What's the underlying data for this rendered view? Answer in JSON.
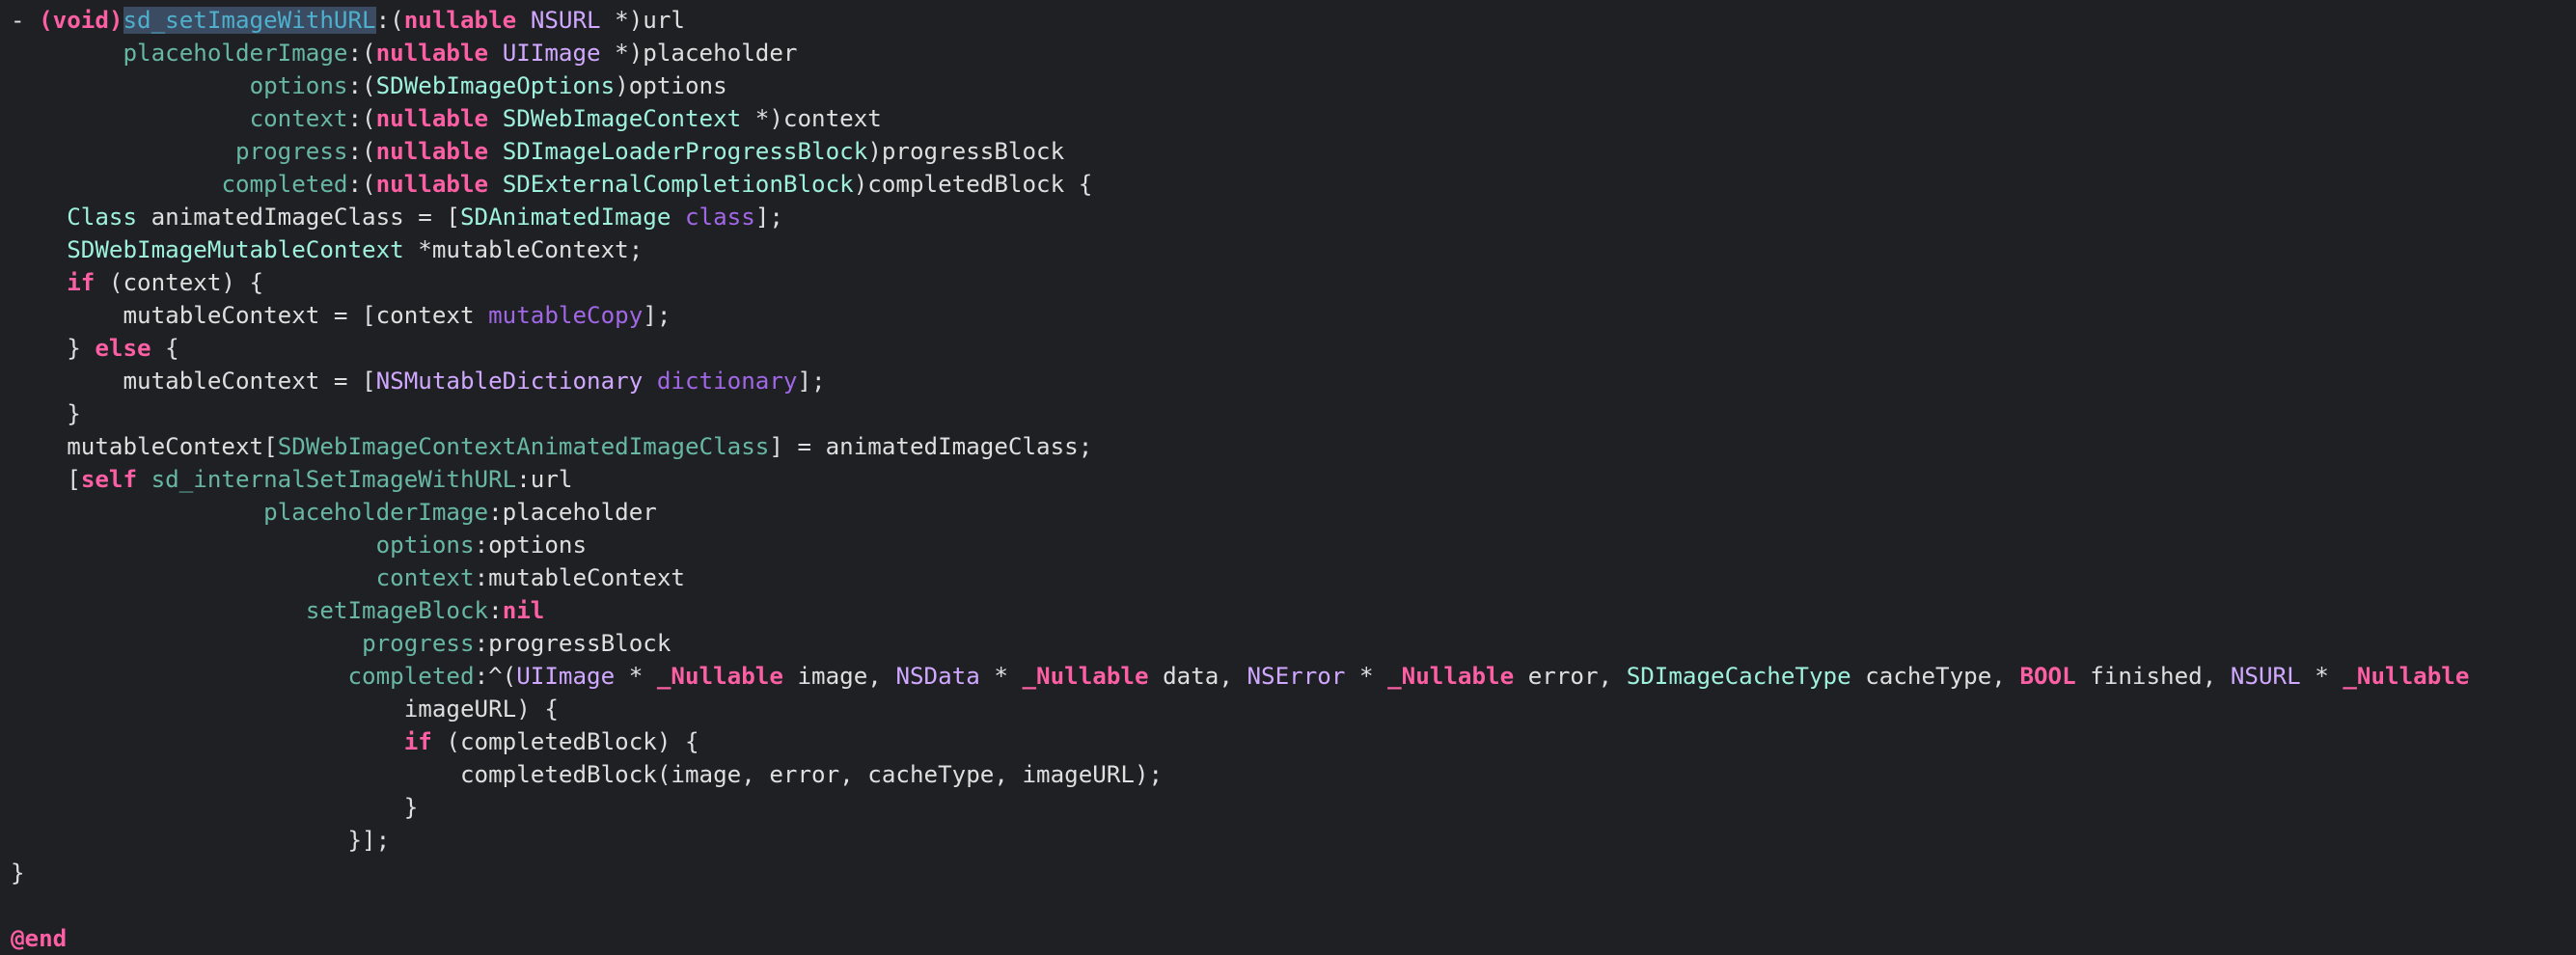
{
  "editor": {
    "background": "#1f2024",
    "selected_text": "sd_setImageWithURL",
    "colors": {
      "text": "#dfdfe0",
      "keyword": "#fc5fa3",
      "system_type": "#d0a8ff",
      "project_type": "#9ef1dd",
      "class_method": "#a167e6",
      "param_label": "#67b7a4",
      "method_name": "#4eb0cc",
      "selection": "#3b4b62"
    },
    "lines": [
      [
        [
          "text",
          "- "
        ],
        [
          "kw",
          "(void)"
        ],
        [
          "hl",
          "sd_setImageWithURL"
        ],
        [
          "text",
          ":("
        ],
        [
          "kw",
          "nullable"
        ],
        [
          "text",
          " "
        ],
        [
          "type",
          "NSURL"
        ],
        [
          "text",
          " *)url"
        ]
      ],
      [
        [
          "text",
          "        "
        ],
        [
          "param",
          "placeholderImage"
        ],
        [
          "text",
          ":("
        ],
        [
          "kw",
          "nullable"
        ],
        [
          "text",
          " "
        ],
        [
          "type",
          "UIImage"
        ],
        [
          "text",
          " *)placeholder"
        ]
      ],
      [
        [
          "text",
          "                 "
        ],
        [
          "param",
          "options"
        ],
        [
          "text",
          ":("
        ],
        [
          "ptype",
          "SDWebImageOptions"
        ],
        [
          "text",
          ")options"
        ]
      ],
      [
        [
          "text",
          "                 "
        ],
        [
          "param",
          "context"
        ],
        [
          "text",
          ":("
        ],
        [
          "kw",
          "nullable"
        ],
        [
          "text",
          " "
        ],
        [
          "ptype",
          "SDWebImageContext"
        ],
        [
          "text",
          " *)context"
        ]
      ],
      [
        [
          "text",
          "                "
        ],
        [
          "param",
          "progress"
        ],
        [
          "text",
          ":("
        ],
        [
          "kw",
          "nullable"
        ],
        [
          "text",
          " "
        ],
        [
          "ptype",
          "SDImageLoaderProgressBlock"
        ],
        [
          "text",
          ")progressBlock"
        ]
      ],
      [
        [
          "text",
          "               "
        ],
        [
          "param",
          "completed"
        ],
        [
          "text",
          ":("
        ],
        [
          "kw",
          "nullable"
        ],
        [
          "text",
          " "
        ],
        [
          "ptype",
          "SDExternalCompletionBlock"
        ],
        [
          "text",
          ")completedBlock {"
        ]
      ],
      [
        [
          "text",
          "    "
        ],
        [
          "ptype",
          "Class"
        ],
        [
          "text",
          " animatedImageClass = ["
        ],
        [
          "ptype",
          "SDAnimatedImage"
        ],
        [
          "text",
          " "
        ],
        [
          "cls",
          "class"
        ],
        [
          "text",
          "];"
        ]
      ],
      [
        [
          "text",
          "    "
        ],
        [
          "ptype",
          "SDWebImageMutableContext"
        ],
        [
          "text",
          " *mutableContext;"
        ]
      ],
      [
        [
          "text",
          "    "
        ],
        [
          "kw",
          "if"
        ],
        [
          "text",
          " (context) {"
        ]
      ],
      [
        [
          "text",
          "        mutableContext = [context "
        ],
        [
          "cls",
          "mutableCopy"
        ],
        [
          "text",
          "];"
        ]
      ],
      [
        [
          "text",
          "    } "
        ],
        [
          "kw",
          "else"
        ],
        [
          "text",
          " {"
        ]
      ],
      [
        [
          "text",
          "        mutableContext = ["
        ],
        [
          "type",
          "NSMutableDictionary"
        ],
        [
          "text",
          " "
        ],
        [
          "cls",
          "dictionary"
        ],
        [
          "text",
          "];"
        ]
      ],
      [
        [
          "text",
          "    }"
        ]
      ],
      [
        [
          "text",
          "    mutableContext["
        ],
        [
          "param",
          "SDWebImageContextAnimatedImageClass"
        ],
        [
          "text",
          "] = animatedImageClass;"
        ]
      ],
      [
        [
          "text",
          "    ["
        ],
        [
          "kw",
          "self"
        ],
        [
          "text",
          " "
        ],
        [
          "param",
          "sd_internalSetImageWithURL"
        ],
        [
          "text",
          ":url"
        ]
      ],
      [
        [
          "text",
          "                  "
        ],
        [
          "param",
          "placeholderImage"
        ],
        [
          "text",
          ":placeholder"
        ]
      ],
      [
        [
          "text",
          "                          "
        ],
        [
          "param",
          "options"
        ],
        [
          "text",
          ":options"
        ]
      ],
      [
        [
          "text",
          "                          "
        ],
        [
          "param",
          "context"
        ],
        [
          "text",
          ":mutableContext"
        ]
      ],
      [
        [
          "text",
          "                     "
        ],
        [
          "param",
          "setImageBlock"
        ],
        [
          "text",
          ":"
        ],
        [
          "kw",
          "nil"
        ]
      ],
      [
        [
          "text",
          "                         "
        ],
        [
          "param",
          "progress"
        ],
        [
          "text",
          ":progressBlock"
        ]
      ],
      [
        [
          "text",
          "                        "
        ],
        [
          "param",
          "completed"
        ],
        [
          "text",
          ":^("
        ],
        [
          "type",
          "UIImage"
        ],
        [
          "text",
          " * "
        ],
        [
          "kw",
          "_Nullable"
        ],
        [
          "text",
          " image, "
        ],
        [
          "type",
          "NSData"
        ],
        [
          "text",
          " * "
        ],
        [
          "kw",
          "_Nullable"
        ],
        [
          "text",
          " data, "
        ],
        [
          "type",
          "NSError"
        ],
        [
          "text",
          " * "
        ],
        [
          "kw",
          "_Nullable"
        ],
        [
          "text",
          " error, "
        ],
        [
          "ptype",
          "SDImageCacheType"
        ],
        [
          "text",
          " cacheType, "
        ],
        [
          "kw",
          "BOOL"
        ],
        [
          "text",
          " finished, "
        ],
        [
          "type",
          "NSURL"
        ],
        [
          "text",
          " * "
        ],
        [
          "kw",
          "_Nullable"
        ]
      ],
      [
        [
          "text",
          "                            imageURL) {"
        ]
      ],
      [
        [
          "text",
          "                            "
        ],
        [
          "kw",
          "if"
        ],
        [
          "text",
          " (completedBlock) {"
        ]
      ],
      [
        [
          "text",
          "                                completedBlock(image, error, cacheType, imageURL);"
        ]
      ],
      [
        [
          "text",
          "                            }"
        ]
      ],
      [
        [
          "text",
          "                        }];"
        ]
      ],
      [
        [
          "text",
          "}"
        ]
      ],
      [
        [
          "text",
          ""
        ]
      ],
      [
        [
          "kw",
          "@end"
        ]
      ]
    ]
  }
}
